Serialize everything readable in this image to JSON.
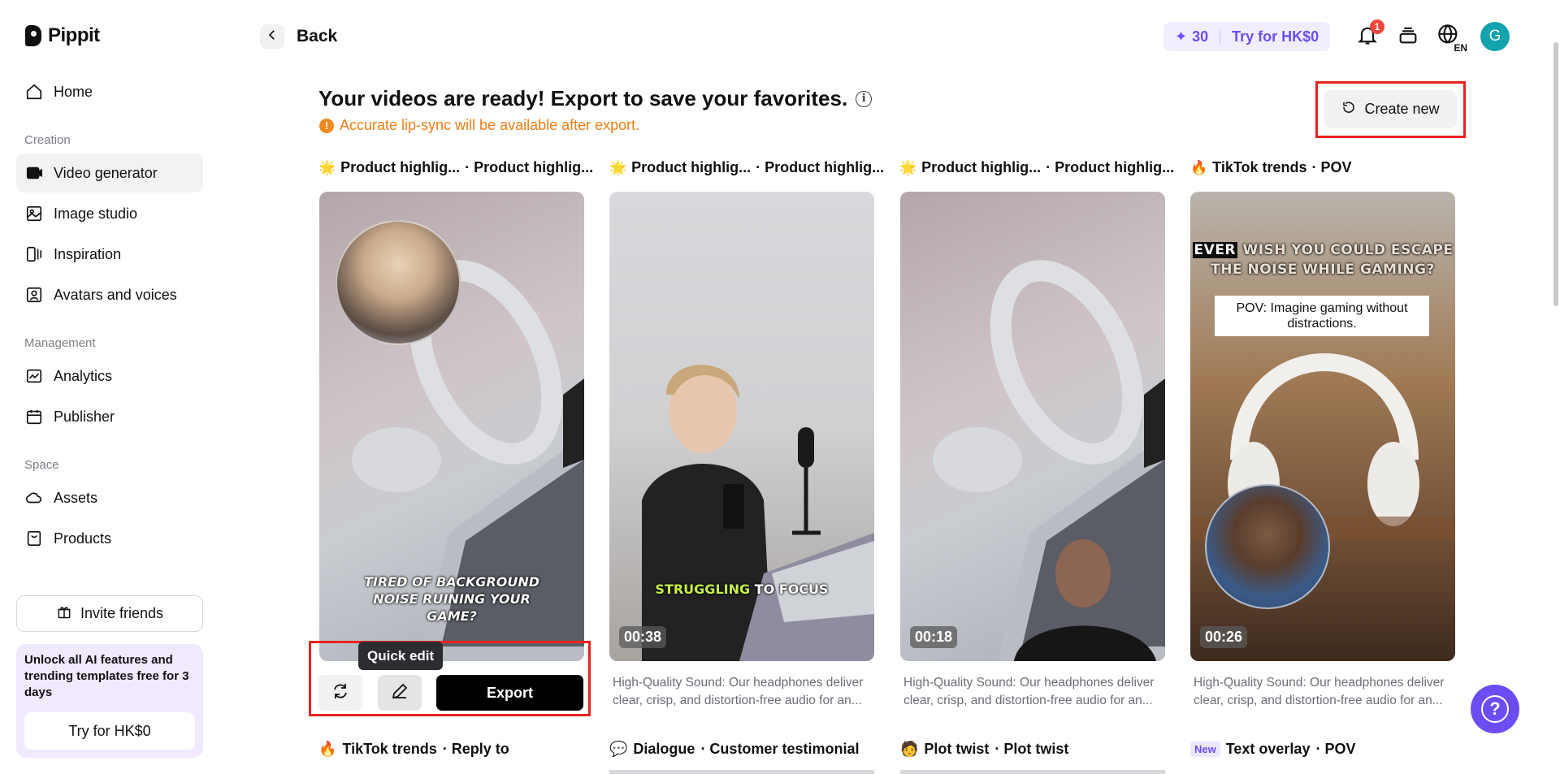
{
  "brand": {
    "name": "Pippit"
  },
  "sidebar": {
    "items": [
      {
        "label": "Home"
      },
      {
        "label": "Video generator"
      },
      {
        "label": "Image studio"
      },
      {
        "label": "Inspiration"
      },
      {
        "label": "Avatars and voices"
      },
      {
        "label": "Analytics"
      },
      {
        "label": "Publisher"
      },
      {
        "label": "Assets"
      },
      {
        "label": "Products"
      }
    ],
    "sections": {
      "creation": "Creation",
      "management": "Management",
      "space": "Space"
    },
    "invite_label": "Invite friends",
    "promo": {
      "text": "Unlock all AI features and trending templates free for 3 days",
      "button": "Try for HK$0"
    }
  },
  "header": {
    "back_label": "Back",
    "credits": "30",
    "try_label": "Try for HK$0",
    "notification_count": "1",
    "language": "EN",
    "avatar_initial": "G"
  },
  "main": {
    "title": "Your videos are ready! Export to save your favorites.",
    "notice": "Accurate lip-sync will be available after export.",
    "create_new_label": "Create new",
    "tooltip": "Quick edit",
    "export_label": "Export",
    "cards": [
      {
        "emoji": "🌟",
        "tag": "Product highlig...",
        "subtitle": "· Product highlig...",
        "caption": "TIRED OF BACKGROUND NOISE RUINING YOUR GAME?",
        "duration": "",
        "desc": ""
      },
      {
        "emoji": "🌟",
        "tag": "Product highlig...",
        "subtitle": "· Product highlig...",
        "caption_highlight": "STRUGGLING",
        "caption": " TO FOCUS",
        "duration": "00:38",
        "desc": "High-Quality Sound: Our headphones deliver clear, crisp, and distortion-free audio for an..."
      },
      {
        "emoji": "🌟",
        "tag": "Product highlig...",
        "subtitle": "· Product highlig...",
        "caption": "",
        "duration": "00:18",
        "desc": "High-Quality Sound: Our headphones deliver clear, crisp, and distortion-free audio for an..."
      },
      {
        "emoji": "🔥",
        "tag": "TikTok trends",
        "subtitle": "· POV",
        "caption_top_1": "EVER",
        "caption_top_2": " WISH YOU COULD ESCAPE",
        "caption_top_3": "THE NOISE WHILE GAMING?",
        "caption": "POV: Imagine gaming without distractions.",
        "duration": "00:26",
        "desc": "High-Quality Sound: Our headphones deliver clear, crisp, and distortion-free audio for an..."
      }
    ],
    "bottom_cards": [
      {
        "emoji": "🔥",
        "tag": "TikTok trends",
        "subtitle": "· Reply to"
      },
      {
        "emoji": "💬",
        "tag": "Dialogue",
        "subtitle": "· Customer testimonial"
      },
      {
        "emoji": "🧑",
        "tag": "Plot twist",
        "subtitle": "· Plot twist"
      },
      {
        "badge": "New",
        "tag": "Text overlay",
        "subtitle": "· POV"
      }
    ]
  }
}
